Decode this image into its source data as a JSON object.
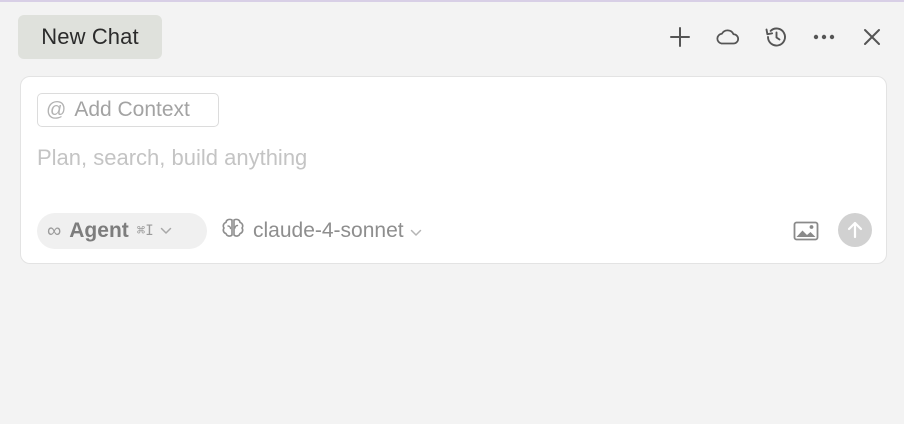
{
  "header": {
    "tab_label": "New Chat",
    "actions": [
      {
        "name": "new-chat",
        "icon": "plus-icon"
      },
      {
        "name": "cloud",
        "icon": "cloud-icon"
      },
      {
        "name": "history",
        "icon": "history-icon"
      },
      {
        "name": "more",
        "icon": "more-horizontal-icon"
      },
      {
        "name": "close",
        "icon": "close-icon"
      }
    ]
  },
  "composer": {
    "add_context_symbol": "@",
    "add_context_label": "Add Context",
    "input_placeholder": "Plan, search, build anything",
    "input_value": "",
    "mode": {
      "icon_glyph": "∞",
      "label": "Agent",
      "shortcut": "⌘I",
      "chevron": "⌄"
    },
    "model": {
      "label": "claude-4-sonnet",
      "chevron": "⌄"
    }
  },
  "colors": {
    "background": "#f3f3f3",
    "tab_bg": "#dfe1dc",
    "accent_line": "#d8cfe6",
    "send_disabled": "#d1d1d1"
  }
}
